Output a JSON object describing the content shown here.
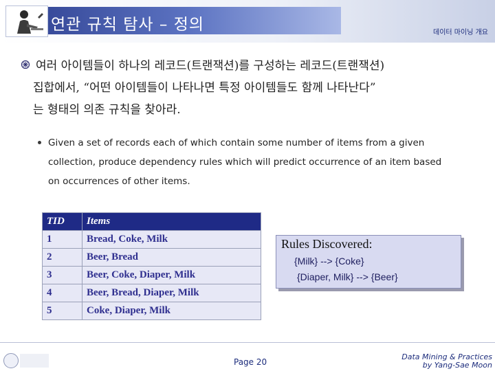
{
  "header": {
    "title": "연관 규칙 탐사 – 정의",
    "course": "데이터 마이닝 개요"
  },
  "main": {
    "korean_lines": [
      "여러 아이템들이 하나의 레코드(트랜잭션)를 구성하는 레코드(트랜잭션)",
      "집합에서, “어떤 아이템들이 나타나면 특정 아이템들도 함께 나타난다”",
      "는 형태의 의존 규칙을 찾아라."
    ],
    "english_lines": [
      "Given a set of records each of which contain some number of items from a given",
      "collection, produce dependency rules which will predict occurrence of an item based",
      "on occurrences of other items."
    ]
  },
  "table": {
    "headers": [
      "TID",
      "Items"
    ],
    "rows": [
      [
        "1",
        "Bread, Coke, Milk"
      ],
      [
        "2",
        "Beer, Bread"
      ],
      [
        "3",
        "Beer, Coke, Diaper, Milk"
      ],
      [
        "4",
        "Beer, Bread, Diaper, Milk"
      ],
      [
        "5",
        "Coke, Diaper, Milk"
      ]
    ]
  },
  "rules": {
    "title": "Rules Discovered:",
    "items": [
      "{Milk} --> {Coke}",
      "{Diaper, Milk} --> {Beer}"
    ]
  },
  "footer": {
    "page": "Page 20",
    "credit_line1": "Data Mining & Practices",
    "credit_line2": "by Yang-Sae Moon"
  }
}
